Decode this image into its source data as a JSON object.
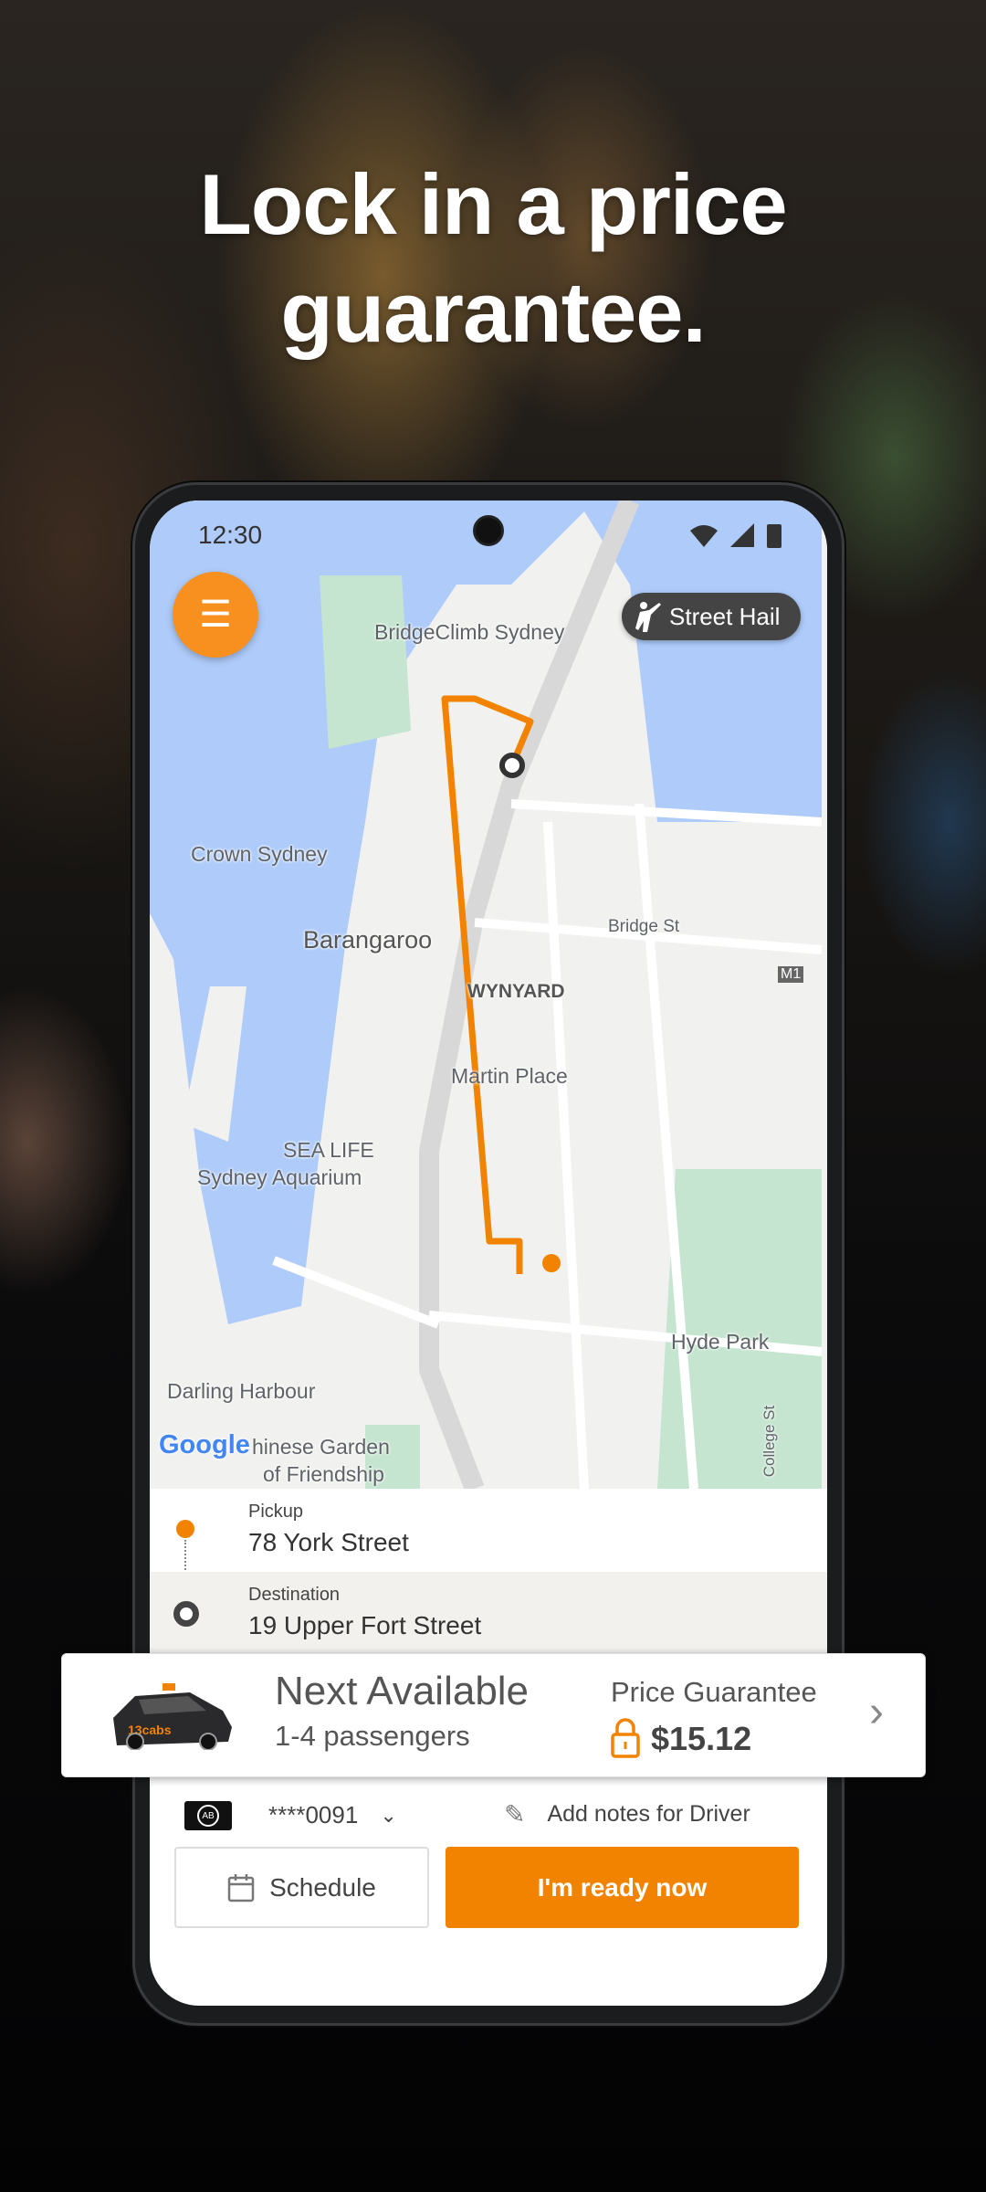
{
  "headline": {
    "line1": "Lock in a price",
    "line2": "guarantee."
  },
  "status_bar": {
    "time": "12:30",
    "icons": [
      "wifi-icon",
      "signal-icon",
      "battery-icon"
    ]
  },
  "map": {
    "street_hail_label": "Street Hail",
    "labels": {
      "bridgeclimb": "BridgeClimb Sydney",
      "crown": "Crown Sydney",
      "barangaroo": "Barangaroo",
      "bridge_st": "Bridge St",
      "wynyard": "WYNYARD",
      "martin_place": "Martin Place",
      "sea_life": "SEA LIFE",
      "aquarium": "Sydney Aquarium",
      "hyde_park": "Hyde Park",
      "darling_harbour": "Darling Harbour",
      "chinese_garden_1": "hinese Garden",
      "chinese_garden_2": "of Friendship",
      "college_st": "College St",
      "m1": "M1",
      "google": "Google"
    },
    "route_color": "#f28300"
  },
  "trip": {
    "pickup_label": "Pickup",
    "pickup_value": "78 York Street",
    "destination_label": "Destination",
    "destination_value": "19 Upper Fort Street"
  },
  "vehicle_card": {
    "title": "Next Available",
    "subtitle": "1-4 passengers",
    "price_label": "Price Guarantee",
    "price": "$15.12",
    "car_brand": "13cabs"
  },
  "payment": {
    "card_badge": "AB",
    "card_number": "****0091",
    "notes": "Add notes for Driver"
  },
  "actions": {
    "schedule": "Schedule",
    "ready": "I'm ready now"
  },
  "colors": {
    "accent": "#f28300",
    "menu": "#f7901e"
  }
}
